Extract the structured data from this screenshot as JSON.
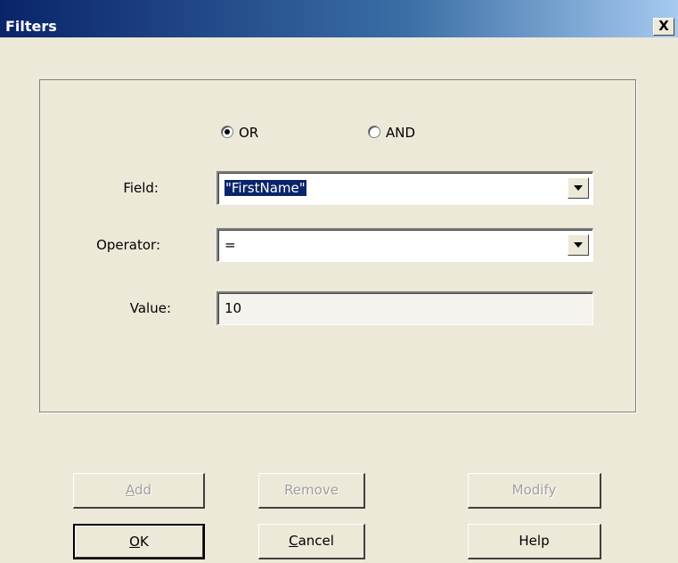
{
  "window": {
    "title": "Filters",
    "close_glyph": "X"
  },
  "logic": {
    "options": [
      {
        "label": "OR",
        "selected": true
      },
      {
        "label": "AND",
        "selected": false
      }
    ]
  },
  "form": {
    "field": {
      "label": "Field:",
      "value": "\"FirstName\""
    },
    "operator": {
      "label": "Operator:",
      "value": "="
    },
    "value": {
      "label": "Value:",
      "value": "10"
    }
  },
  "buttons": {
    "add": {
      "label": "Add",
      "mnemonic": "A",
      "rest": "dd",
      "enabled": false
    },
    "remove": {
      "label": "Remove",
      "enabled": false
    },
    "modify": {
      "label": "Modify",
      "enabled": false
    },
    "ok": {
      "label": "OK",
      "mnemonic": "O",
      "rest": "K",
      "enabled": true,
      "default": true
    },
    "cancel": {
      "label": "Cancel",
      "mnemonic": "C",
      "rest": "ancel",
      "enabled": true
    },
    "help": {
      "label": "Help",
      "enabled": true
    }
  },
  "colors": {
    "dialog_bg": "#ece9d8",
    "titlebar_start": "#0a246a",
    "titlebar_end": "#a6caf0",
    "selection": "#0a246a",
    "disabled_text": "#a0a0a0"
  }
}
